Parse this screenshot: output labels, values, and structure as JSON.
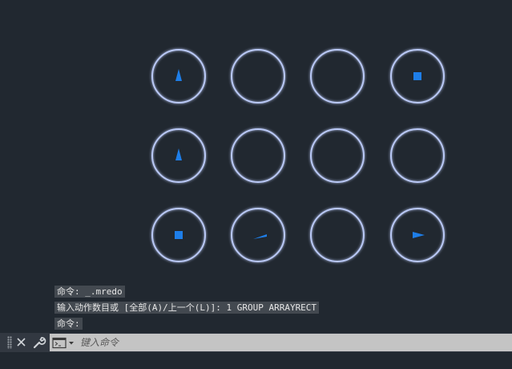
{
  "canvas": {
    "circle_color": "#b9c8f5",
    "circle_glow": "#5f7fe0",
    "marker_color": "#1e7ee8",
    "grid": [
      [
        "arrow-up",
        "empty",
        "empty",
        "square"
      ],
      [
        "arrow-up",
        "empty",
        "empty",
        "empty"
      ],
      [
        "square",
        "arrow-left",
        "empty",
        "arrow-right"
      ]
    ]
  },
  "history": {
    "line1": "命令: _.mredo",
    "line2": "输入动作数目或 [全部(A)/上一个(L)]: 1 GROUP ARRAYRECT",
    "line3": "命令:"
  },
  "command_bar": {
    "close_icon": "close-icon",
    "customize_icon": "wrench-icon",
    "prompt_icon": "command-prompt-icon",
    "placeholder": "键入命令"
  }
}
